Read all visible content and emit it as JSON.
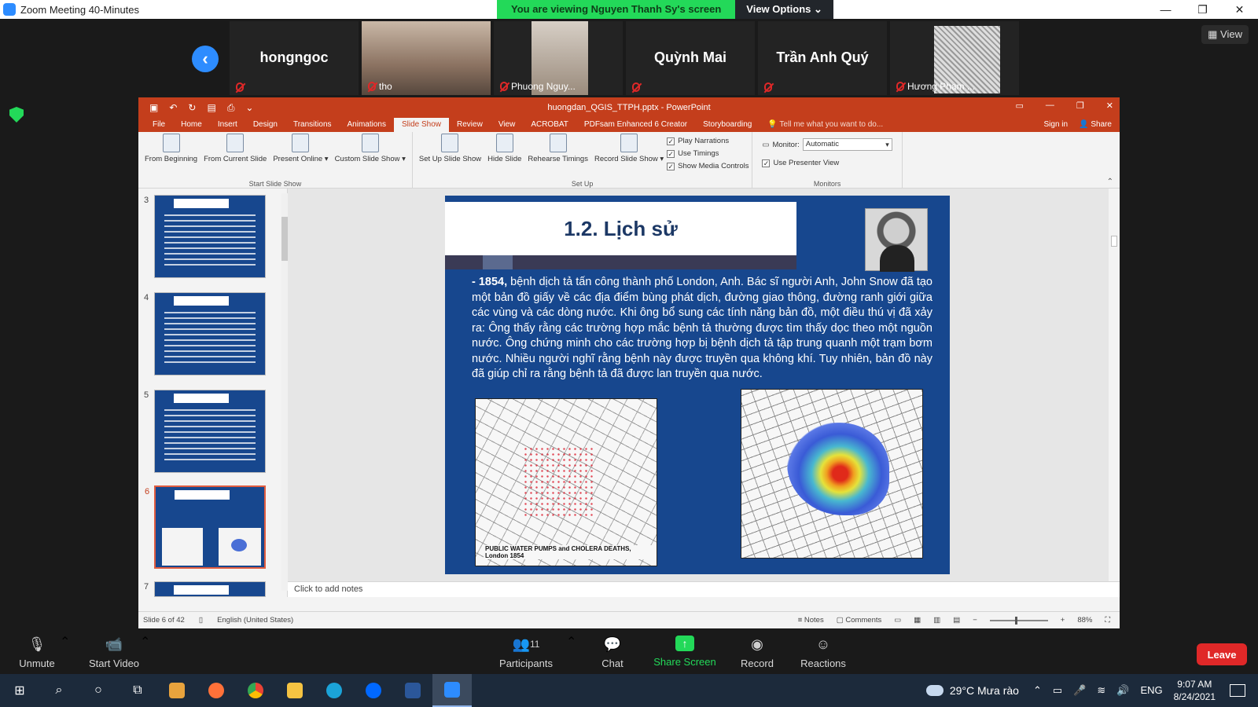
{
  "zoom": {
    "window_title": "Zoom Meeting 40-Minutes",
    "viewing_banner": "You are viewing Nguyen Thanh Sy's screen",
    "view_options": "View Options ⌄",
    "view_button": "View",
    "participants": [
      {
        "name": "hongngoc",
        "video": false
      },
      {
        "name": "tho",
        "video": true
      },
      {
        "name": "Phuong Nguy...",
        "video": true
      },
      {
        "name": "Quỳnh Mai",
        "video": false
      },
      {
        "name": "Trần Anh Quý",
        "video": false
      },
      {
        "name": "Hương Phạm ...",
        "video": true
      }
    ],
    "controls": {
      "unmute": "Unmute",
      "start_video": "Start Video",
      "participants": "Participants",
      "participants_count": "11",
      "chat": "Chat",
      "share_screen": "Share Screen",
      "record": "Record",
      "reactions": "Reactions",
      "leave": "Leave"
    }
  },
  "ppt": {
    "title": "huongdan_QGIS_TTPH.pptx - PowerPoint",
    "tabs": [
      "File",
      "Home",
      "Insert",
      "Design",
      "Transitions",
      "Animations",
      "Slide Show",
      "Review",
      "View",
      "ACROBAT",
      "PDFsam Enhanced 6 Creator",
      "Storyboarding"
    ],
    "active_tab": "Slide Show",
    "tell_me": "Tell me what you want to do...",
    "sign_in": "Sign in",
    "share": "Share",
    "ribbon": {
      "start_group": "Start Slide Show",
      "from_beginning": "From Beginning",
      "from_current": "From Current Slide",
      "present_online": "Present Online ▾",
      "custom_show": "Custom Slide Show ▾",
      "setup_group": "Set Up",
      "setup_show": "Set Up Slide Show",
      "hide_slide": "Hide Slide",
      "rehearse": "Rehearse Timings",
      "record_show": "Record Slide Show ▾",
      "play_narrations": "Play Narrations",
      "use_timings": "Use Timings",
      "show_media": "Show Media Controls",
      "monitors_group": "Monitors",
      "monitor_label": "Monitor:",
      "monitor_value": "Automatic",
      "presenter_view": "Use Presenter View"
    },
    "thumbnails": [
      {
        "num": "3",
        "title": "Nội dung trình bày",
        "selected": false
      },
      {
        "num": "4",
        "title": "1. Sơ lược về GIS",
        "selected": false
      },
      {
        "num": "5",
        "title": "1.1. Khái niệm",
        "selected": false
      },
      {
        "num": "6",
        "title": "1.2. Lịch sử",
        "selected": true
      },
      {
        "num": "7",
        "title": "1.2. Lịch sử",
        "selected": false
      }
    ],
    "slide": {
      "title": "1.2. Lịch sử",
      "body_bold": "- 1854,",
      "body_text": " bệnh dịch tả tấn công thành phố London, Anh. Bác sĩ người Anh, John Snow đã tạo một bản đồ giấy về các địa điểm bùng phát dịch, đường giao thông, đường ranh giới giữa các vùng và các dòng nước. Khi ông bổ sung các tính năng bản đồ, một điều thú vị đã xảy ra: Ông thấy rằng các trường hợp mắc bệnh tả thường được tìm thấy dọc theo một nguồn nước. Ông chứng minh cho các trường hợp bị bệnh dịch tả tập trung quanh một trạm bơm nước. Nhiều người nghĩ rằng bệnh này được truyền qua không khí. Tuy nhiên, bản đồ này đã giúp chỉ ra rằng bệnh tả đã được lan truyền qua nước.",
      "map_caption": "PUBLIC WATER PUMPS and CHOLERA DEATHS, London 1854"
    },
    "notes_placeholder": "Click to add notes",
    "status": {
      "slide": "Slide 6 of 42",
      "language": "English (United States)",
      "notes": "Notes",
      "comments": "Comments",
      "zoom": "88%"
    }
  },
  "taskbar": {
    "weather": "29°C  Mưa rào",
    "lang": "ENG",
    "time": "9:07 AM",
    "date": "8/24/2021"
  }
}
